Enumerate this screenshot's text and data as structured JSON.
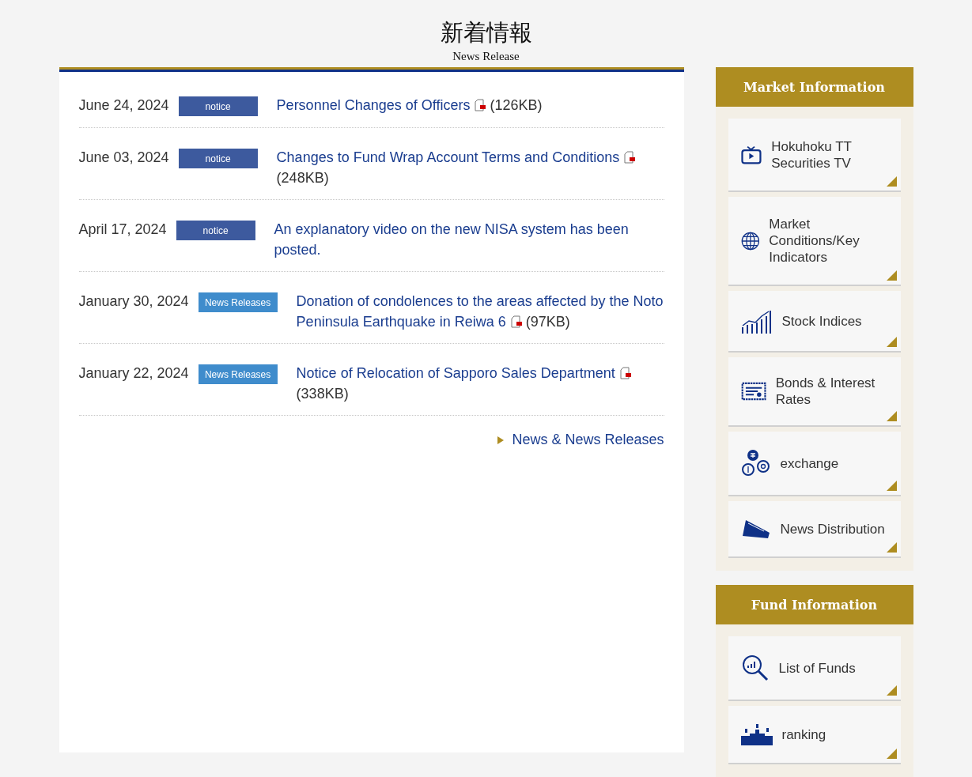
{
  "heading": {
    "title": "新着情報",
    "subtitle": "News Release"
  },
  "news": [
    {
      "date": "June 24, 2024",
      "tag": "notice",
      "kind": "notice",
      "title": "Personnel Changes of Officers",
      "size": "(126KB)"
    },
    {
      "date": "June 03, 2024",
      "tag": "notice",
      "kind": "notice",
      "title": "Changes to Fund Wrap Account Terms and Conditions",
      "size": "(248KB)"
    },
    {
      "date": "April 17, 2024",
      "tag": "notice",
      "kind": "notice",
      "title": "An explanatory video on the new NISA system has been posted."
    },
    {
      "date": "January 30, 2024",
      "tag": "News Releases",
      "kind": "release",
      "title": "Donation of condolences to the areas affected by the Noto Peninsula Earthquake in Reiwa 6",
      "size": "(97KB)"
    },
    {
      "date": "January 22, 2024",
      "tag": "News Releases",
      "kind": "release",
      "title": "Notice of Relocation of Sapporo Sales Department",
      "size": "(338KB)"
    }
  ],
  "more_link": "News & News Releases",
  "sidebar": [
    {
      "title": "Market Information",
      "items": [
        {
          "label": "Hokuhoku TT Securities TV",
          "kind": "tv"
        },
        {
          "label": "Market Conditions/Key Indicators",
          "kind": "globe"
        },
        {
          "label": "Stock Indices",
          "kind": "chart"
        },
        {
          "label": "Bonds & Interest Rates",
          "kind": "bond"
        },
        {
          "label": "exchange",
          "kind": "coins"
        },
        {
          "label": "News Distribution",
          "kind": "megaphone"
        }
      ]
    },
    {
      "title": "Fund Information",
      "items": [
        {
          "label": "List of Funds",
          "kind": "search"
        },
        {
          "label": "ranking",
          "kind": "podium"
        }
      ]
    }
  ]
}
